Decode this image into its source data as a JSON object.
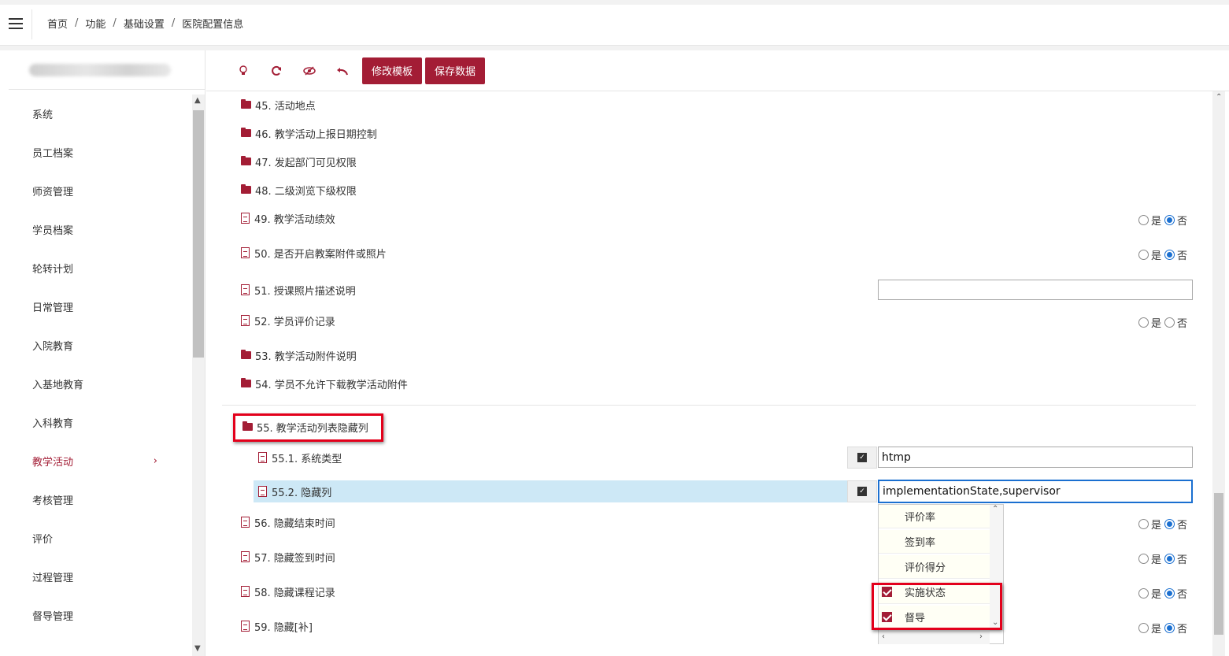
{
  "breadcrumb": [
    "首页",
    "功能",
    "基础设置",
    "医院配置信息"
  ],
  "breadcrumb_sep": "/",
  "sidebar": {
    "items": [
      {
        "label": "系统"
      },
      {
        "label": "员工档案"
      },
      {
        "label": "师资管理"
      },
      {
        "label": "学员档案"
      },
      {
        "label": "轮转计划"
      },
      {
        "label": "日常管理"
      },
      {
        "label": "入院教育"
      },
      {
        "label": "入基地教育"
      },
      {
        "label": "入科教育"
      },
      {
        "label": "教学活动",
        "active": true,
        "chevron": "›"
      },
      {
        "label": "考核管理"
      },
      {
        "label": "评价"
      },
      {
        "label": "过程管理"
      },
      {
        "label": "督导管理"
      }
    ]
  },
  "toolbar": {
    "icons": [
      "lightbulb-icon",
      "refresh-icon",
      "eye-slash-icon",
      "undo-icon"
    ],
    "edit_template": "修改模板",
    "save_data": "保存数据"
  },
  "radio": {
    "yes": "是",
    "no": "否"
  },
  "tree": {
    "r45": "45. 活动地点",
    "r46": "46. 教学活动上报日期控制",
    "r47": "47. 发起部门可见权限",
    "r48": "48. 二级浏览下级权限",
    "r49": "49. 教学活动绩效",
    "r50": "50. 是否开启教案附件或照片",
    "r51": "51. 授课照片描述说明",
    "r52": "52. 学员评价记录",
    "r53": "53. 教学活动附件说明",
    "r54": "54. 学员不允许下载教学活动附件",
    "r55": "55. 教学活动列表隐藏列",
    "r551": "55.1. 系统类型",
    "r552": "55.2. 隐藏列",
    "r56": "56. 隐藏结束时间",
    "r57": "57. 隐藏签到时间",
    "r58": "58. 隐藏课程记录",
    "r59": "59. 隐藏[补]"
  },
  "inputs": {
    "r51_value": "",
    "r551_value": "htmp",
    "r552_value": "implementationState,supervisor"
  },
  "dropdown": {
    "options": [
      {
        "label": "评价率",
        "checked": false
      },
      {
        "label": "签到率",
        "checked": false
      },
      {
        "label": "评价得分",
        "checked": false
      },
      {
        "label": "实施状态",
        "checked": true
      },
      {
        "label": "督导",
        "checked": true
      }
    ]
  },
  "colors": {
    "accent": "#a31d35",
    "highlight": "#cde8f6",
    "annotation": "#e3001b",
    "radio_on": "#1a6fd0"
  }
}
